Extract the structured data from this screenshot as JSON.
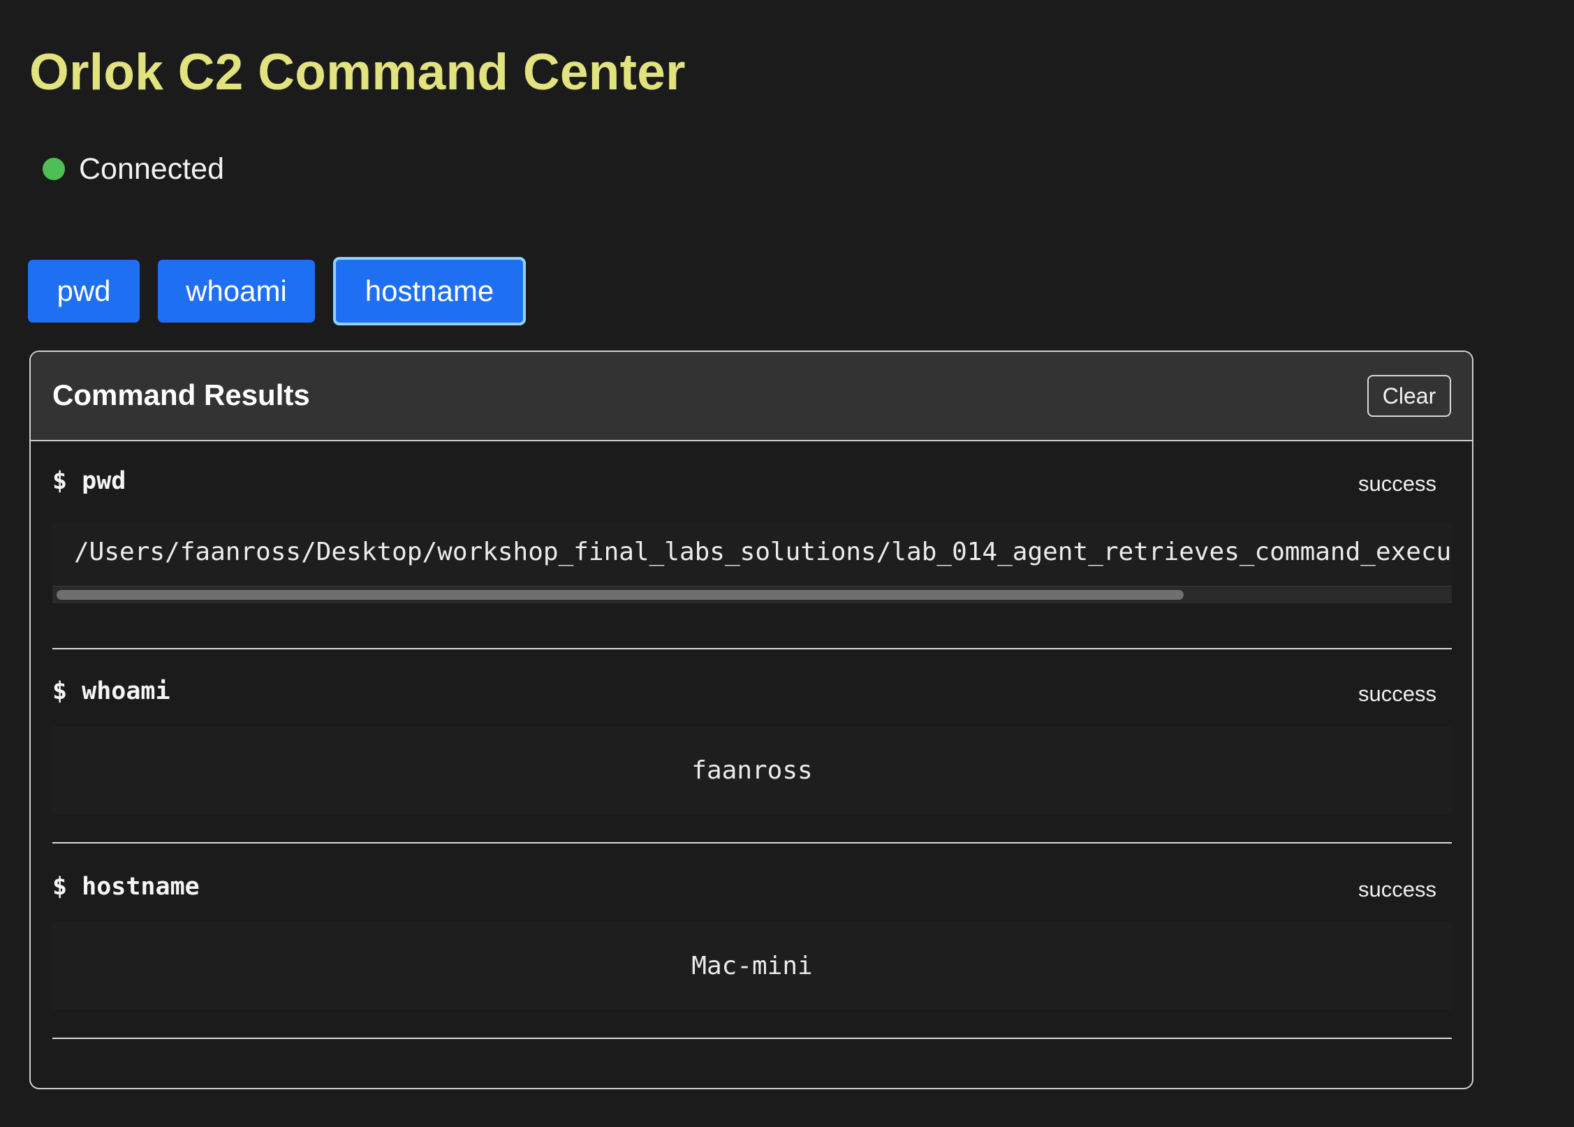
{
  "header": {
    "title": "Orlok C2 Command Center"
  },
  "connection": {
    "status_text": "Connected",
    "status_color": "#4fbf55"
  },
  "commands": {
    "buttons": [
      {
        "label": "pwd"
      },
      {
        "label": "whoami"
      },
      {
        "label": "hostname",
        "focused": true
      }
    ]
  },
  "results_panel": {
    "title": "Command Results",
    "clear_label": "Clear",
    "items": [
      {
        "command": "$ pwd",
        "status": "success",
        "output": "/Users/faanross/Desktop/workshop_final_labs_solutions/lab_014_agent_retrieves_command_execu",
        "horizontal_scroll_visible_fraction": 0.81
      },
      {
        "command": "$ whoami",
        "status": "success",
        "output": "faanross"
      },
      {
        "command": "$ hostname",
        "status": "success",
        "output": "Mac-mini"
      }
    ]
  },
  "colors": {
    "background": "#1b1b1b",
    "title": "#e2e27e",
    "button": "#1f6ff2",
    "button_focus_ring": "#8fd3fb",
    "panel_header": "#333333"
  }
}
